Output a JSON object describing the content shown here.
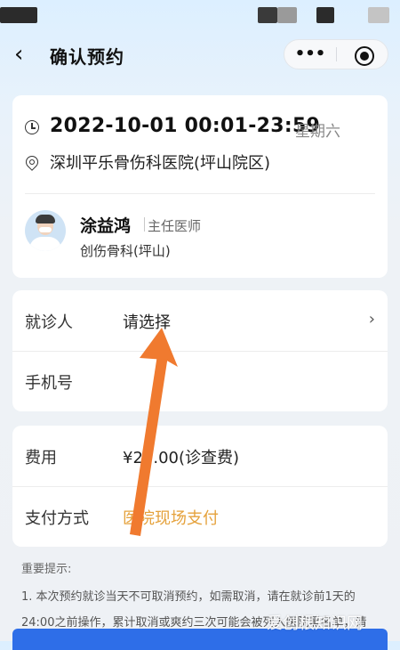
{
  "navbar": {
    "back_icon": "chevron-left-icon",
    "title": "确认预约",
    "more_label": "•••",
    "target_icon": "target-icon"
  },
  "appointment": {
    "datetime": "2022-10-01 00:01-23:59",
    "weekday": "星期六",
    "hospital": "深圳平乐骨伤科医院(坪山院区)"
  },
  "doctor": {
    "name": "涂益鸿",
    "title": "主任医师",
    "department": "创伤骨科(坪山)"
  },
  "form": {
    "patient_label": "就诊人",
    "patient_value": "请选择",
    "phone_label": "手机号",
    "phone_value": ""
  },
  "payment": {
    "fee_label": "费用",
    "fee_value": "¥25.00(诊查费)",
    "method_label": "支付方式",
    "method_value": "医院现场支付"
  },
  "tips": {
    "title": "重要提示:",
    "line1": "1. 本次预约就诊当天不可取消预约，如需取消，请在就诊前1天的",
    "line2": "24:00之前操作，累计取消或爽约三次可能会被列入医院黑名单，请"
  },
  "watermark": "爱创根知识网",
  "colors": {
    "accent": "#2e6ee8",
    "pay_method": "#e5a23c",
    "arrow": "#f07a2f"
  }
}
